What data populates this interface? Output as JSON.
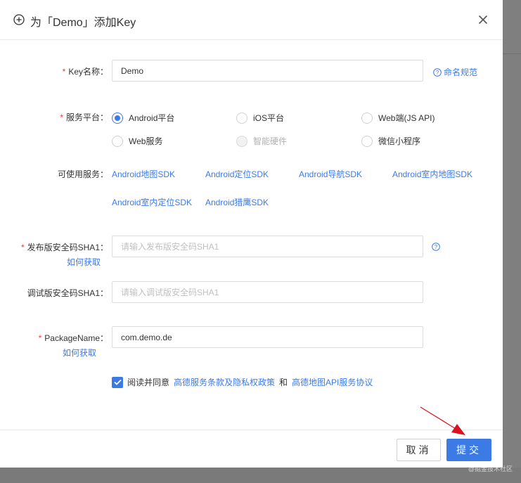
{
  "dialog": {
    "title": "为「Demo」添加Key",
    "header_icon": "circle-plus-icon",
    "close_icon": "close-icon"
  },
  "key_name": {
    "label": "Key名称：",
    "required": "*",
    "value": "Demo",
    "help_label": "命名规范"
  },
  "service_platform": {
    "label": "服务平台：",
    "required": "*",
    "options": [
      {
        "label": "Android平台",
        "state": "checked"
      },
      {
        "label": "iOS平台",
        "state": "unchecked"
      },
      {
        "label": "Web端(JS API)",
        "state": "unchecked"
      },
      {
        "label": "Web服务",
        "state": "unchecked"
      },
      {
        "label": "智能硬件",
        "state": "disabled"
      },
      {
        "label": "微信小程序",
        "state": "unchecked"
      }
    ]
  },
  "available_services": {
    "label": "可使用服务：",
    "items": [
      "Android地图SDK",
      "Android定位SDK",
      "Android导航SDK",
      "Android室内地图SDK",
      "Android室内定位SDK",
      "Android猎鹰SDK"
    ]
  },
  "release_sha1": {
    "label": "发布版安全码SHA1：",
    "required": "*",
    "how_to": "如何获取",
    "placeholder": "请输入发布版安全码SHA1",
    "value": ""
  },
  "debug_sha1": {
    "label": "调试版安全码SHA1：",
    "placeholder": "请输入调试版安全码SHA1",
    "value": ""
  },
  "package_name": {
    "label": "PackageName：",
    "required": "*",
    "how_to": "如何获取",
    "value": "com.demo.de"
  },
  "agreement": {
    "checked": true,
    "prefix": "阅读并同意",
    "link1": "高德服务条款及隐私权政策",
    "joiner": "和",
    "link2": "高德地图API服务协议"
  },
  "footer": {
    "cancel_label": "取消",
    "submit_label": "提交"
  },
  "watermark": "@掘金技术社区",
  "colors": {
    "accent": "#3c7ae6",
    "required": "#e53e3e",
    "annotation_arrow": "#d9121f"
  }
}
